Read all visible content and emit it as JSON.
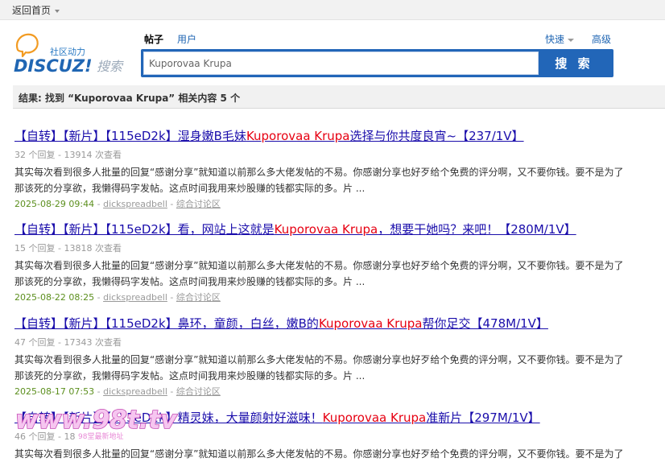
{
  "topbar": {
    "home_label": "返回首页"
  },
  "logo": {
    "subtitle": "社区动力",
    "brand": "DISCUZ!",
    "suffix": "搜索"
  },
  "search": {
    "tabs": [
      {
        "label": "帖子",
        "active": true
      },
      {
        "label": "用户",
        "active": false
      }
    ],
    "quick_label": "快速",
    "advanced_label": "高级",
    "query": "Kuporovaa Krupa",
    "button_label": "搜 索"
  },
  "summary": {
    "text": "结果: 找到 “Kuporovaa Krupa” 相关内容 5 个"
  },
  "results": [
    {
      "title_pre": "【自转】【新片】【115eD2k】湿身嫩B毛妹",
      "title_hl": "Kuporovaa Krupa",
      "title_post": "选择与你共度良宵~【237/1V】",
      "meta": "32 个回复 - 13914 次查看",
      "desc": "其实每次看到很多人批量的回复“感谢分享”就知道以前那么多大佬发帖的不易。你感谢分享也好歹给个免费的评分啊，又不要你钱。要不是为了那该死的分享欲，我懒得码字发帖。这点时间我用来炒股赚的钱都实际的多。片 ...",
      "date": "2025-08-29 09:44",
      "author": "dickspreadbell",
      "forum": "综合讨论区"
    },
    {
      "title_pre": "【自转】【新片】【115eD2k】看，网站上这就是",
      "title_hl": "Kuporovaa Krupa",
      "title_post": "，想要干她吗？来吧！【280M/1V】",
      "meta": "15 个回复 - 13818 次查看",
      "desc": "其实每次看到很多人批量的回复“感谢分享”就知道以前那么多大佬发帖的不易。你感谢分享也好歹给个免费的评分啊，又不要你钱。要不是为了那该死的分享欲，我懒得码字发帖。这点时间我用来炒股赚的钱都实际的多。片 ...",
      "date": "2025-08-22 08:25",
      "author": "dickspreadbell",
      "forum": "综合讨论区"
    },
    {
      "title_pre": "【自转】【新片】【115eD2k】鼻环，童颜，白丝，嫩B的",
      "title_hl": "Kuporovaa Krupa",
      "title_post": "帮你足交【478M/1V】",
      "meta": "47 个回复 - 17343 次查看",
      "desc": "其实每次看到很多人批量的回复“感谢分享”就知道以前那么多大佬发帖的不易。你感谢分享也好歹给个免费的评分啊，又不要你钱。要不是为了那该死的分享欲，我懒得码字发帖。这点时间我用来炒股赚的钱都实际的多。片 ...",
      "date": "2025-08-17 07:53",
      "author": "dickspreadbell",
      "forum": "综合讨论区"
    },
    {
      "title_pre": "【自转】【新片】【115eD2k】精灵妹，大量颜射好滋味！",
      "title_hl": "Kuporovaa Krupa",
      "title_post": "准新片【297M/1V】",
      "meta": "46 个回复 - 18",
      "desc": "其实每次看到很多人批量的回复“感谢分享”就知道以前那么多大佬发帖的不易。你感谢分享也好歹给个免费的评分啊，又不要你钱。要不是为了",
      "date": "",
      "author": "",
      "forum": ""
    }
  ],
  "watermark": {
    "text": "www.98t.tv",
    "sub": "98堂最新地址"
  },
  "colors": {
    "link": "#1a0dab",
    "highlight": "#e60012",
    "date": "#5c8f1e",
    "search_blue": "#2266b8"
  }
}
